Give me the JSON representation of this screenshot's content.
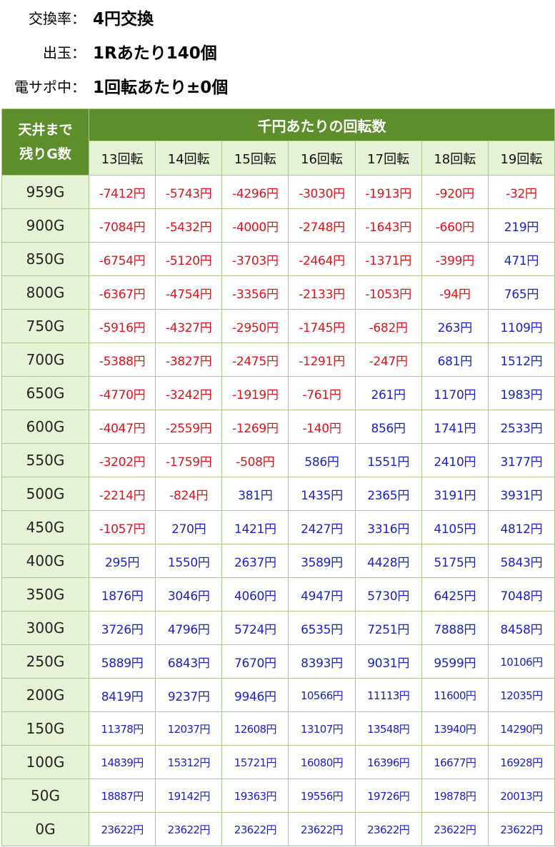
{
  "info": [
    {
      "label": "交換率：",
      "value": "4円交換"
    },
    {
      "label": "出玉：",
      "value": "1Rあたり140個"
    },
    {
      "label": "電サポ中：",
      "value": "1回転あたり±0個"
    }
  ],
  "table": {
    "corner_label": [
      "天井まで",
      "残りG数"
    ],
    "group_label": "千円あたりの回転数",
    "columns": [
      "13回転",
      "14回転",
      "15回転",
      "16回転",
      "17回転",
      "18回転",
      "19回転"
    ],
    "rows": [
      {
        "g": "959G",
        "values": [
          "-7412円",
          "-5743円",
          "-4296円",
          "-3030円",
          "-1913円",
          "-920円",
          "-32円"
        ]
      },
      {
        "g": "900G",
        "values": [
          "-7084円",
          "-5432円",
          "-4000円",
          "-2748円",
          "-1643円",
          "-660円",
          "219円"
        ]
      },
      {
        "g": "850G",
        "values": [
          "-6754円",
          "-5120円",
          "-3703円",
          "-2464円",
          "-1371円",
          "-399円",
          "471円"
        ]
      },
      {
        "g": "800G",
        "values": [
          "-6367円",
          "-4754円",
          "-3356円",
          "-2133円",
          "-1053円",
          "-94円",
          "765円"
        ]
      },
      {
        "g": "750G",
        "values": [
          "-5916円",
          "-4327円",
          "-2950円",
          "-1745円",
          "-682円",
          "263円",
          "1109円"
        ]
      },
      {
        "g": "700G",
        "values": [
          "-5388円",
          "-3827円",
          "-2475円",
          "-1291円",
          "-247円",
          "681円",
          "1512円"
        ]
      },
      {
        "g": "650G",
        "values": [
          "-4770円",
          "-3242円",
          "-1919円",
          "-761円",
          "261円",
          "1170円",
          "1983円"
        ]
      },
      {
        "g": "600G",
        "values": [
          "-4047円",
          "-2559円",
          "-1269円",
          "-140円",
          "856円",
          "1741円",
          "2533円"
        ]
      },
      {
        "g": "550G",
        "values": [
          "-3202円",
          "-1759円",
          "-508円",
          "586円",
          "1551円",
          "2410円",
          "3177円"
        ]
      },
      {
        "g": "500G",
        "values": [
          "-2214円",
          "-824円",
          "381円",
          "1435円",
          "2365円",
          "3191円",
          "3931円"
        ]
      },
      {
        "g": "450G",
        "values": [
          "-1057円",
          "270円",
          "1421円",
          "2427円",
          "3316円",
          "4105円",
          "4812円"
        ]
      },
      {
        "g": "400G",
        "values": [
          "295円",
          "1550円",
          "2637円",
          "3589円",
          "4428円",
          "5175円",
          "5843円"
        ]
      },
      {
        "g": "350G",
        "values": [
          "1876円",
          "3046円",
          "4060円",
          "4947円",
          "5730円",
          "6425円",
          "7048円"
        ]
      },
      {
        "g": "300G",
        "values": [
          "3726円",
          "4796円",
          "5724円",
          "6535円",
          "7251円",
          "7888円",
          "8458円"
        ]
      },
      {
        "g": "250G",
        "values": [
          "5889円",
          "6843円",
          "7670円",
          "8393円",
          "9031円",
          "9599円",
          "10106円"
        ]
      },
      {
        "g": "200G",
        "values": [
          "8419円",
          "9237円",
          "9946円",
          "10566円",
          "11113円",
          "11600円",
          "12035円"
        ]
      },
      {
        "g": "150G",
        "values": [
          "11378円",
          "12037円",
          "12608円",
          "13107円",
          "13548円",
          "13940円",
          "14290円"
        ]
      },
      {
        "g": "100G",
        "values": [
          "14839円",
          "15312円",
          "15721円",
          "16080円",
          "16396円",
          "16677円",
          "16928円"
        ]
      },
      {
        "g": "50G",
        "values": [
          "18887円",
          "19142円",
          "19363円",
          "19556円",
          "19726円",
          "19878円",
          "20013円"
        ]
      },
      {
        "g": "0G",
        "values": [
          "23622円",
          "23622円",
          "23622円",
          "23622円",
          "23622円",
          "23622円",
          "23622円"
        ]
      }
    ]
  },
  "colors": {
    "negative": "#e0141c",
    "positive": "#1a23c8",
    "header_bg": "#5e8e2c",
    "sub_bg": "#e6f2d5"
  }
}
